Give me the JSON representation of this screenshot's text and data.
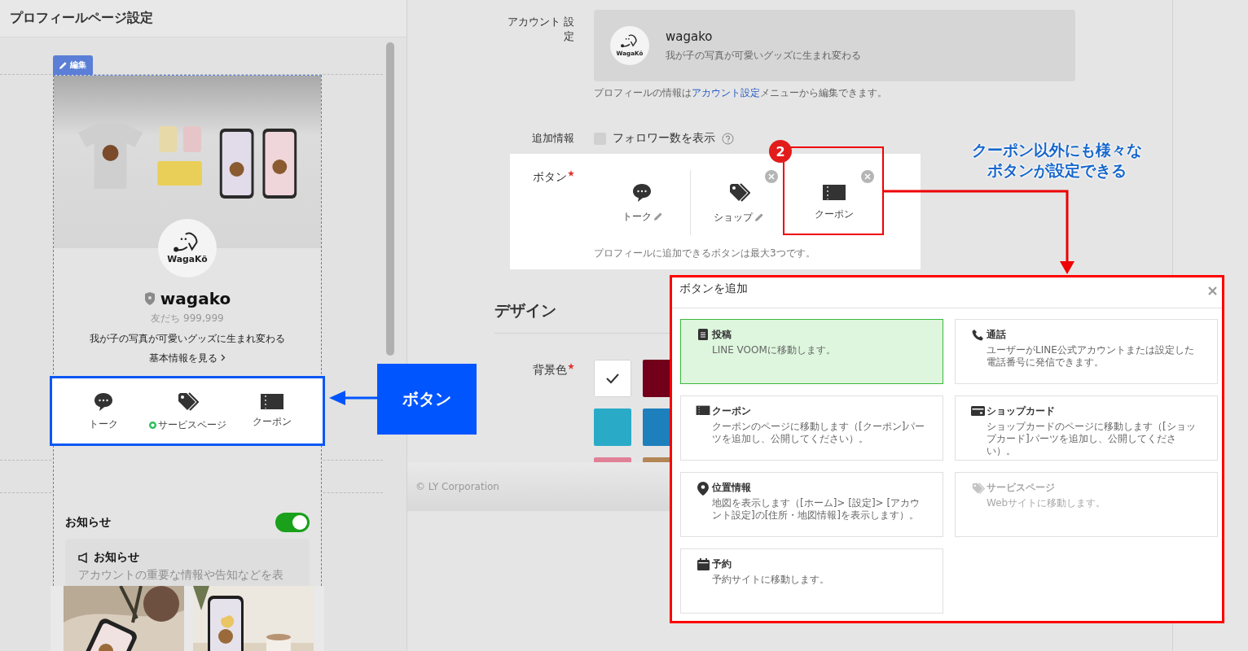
{
  "page_title": "プロフィールページ設定",
  "preview": {
    "edit_tab": "編集",
    "logo_text": "WagaKö",
    "account_name": "wagako",
    "friends": "友だち 999,999",
    "status_message": "我が子の写真が可愛いグッズに生まれ変わる",
    "info_link": "基本情報を見る",
    "buttons": [
      {
        "label": "トーク",
        "kind": "talk"
      },
      {
        "label": "サービスページ",
        "kind": "service"
      },
      {
        "label": "クーポン",
        "kind": "coupon"
      }
    ],
    "news": {
      "title": "お知らせ",
      "on": true,
      "card_title": "お知らせ",
      "card_text": "アカウントの重要な情報や告知などを表"
    }
  },
  "account": {
    "label": "アカウント 設定",
    "logo_text": "WagaKö",
    "name": "wagako",
    "description": "我が子の写真が可愛いグッズに生まれ変わる",
    "note_before": "プロフィールの情報は",
    "note_link": "アカウント設定",
    "note_after": "メニューから編集できます。"
  },
  "extra_info": {
    "label": "追加情報",
    "option": "フォロワー数を表示",
    "checked": false
  },
  "buttons_setting": {
    "label": "ボタン",
    "required": true,
    "items": [
      {
        "label": "トーク",
        "kind": "talk",
        "editable": true,
        "removable": false
      },
      {
        "label": "ショップ",
        "kind": "shop",
        "editable": true,
        "removable": true
      },
      {
        "label": "クーポン",
        "kind": "coupon",
        "editable": false,
        "removable": true
      }
    ],
    "note": "プロフィールに追加できるボタンは最大3つです。"
  },
  "design": {
    "heading": "デザイン",
    "background_label": "背景色",
    "required": true,
    "swatches": [
      {
        "color": "#ffffff",
        "selected": true
      },
      {
        "color": "#72001a",
        "selected": false
      },
      {
        "color": "#29abc8",
        "selected": false
      },
      {
        "color": "#1e7fbd",
        "selected": false
      },
      {
        "color": "#e08198",
        "selected": false
      },
      {
        "color": "#b38656",
        "selected": false
      }
    ]
  },
  "footer": "© LY Corporation",
  "dialog": {
    "title": "ボタンを追加",
    "options": [
      {
        "kind": "post",
        "title": "投稿",
        "description": "LINE VOOMに移動します。",
        "selected": true,
        "disabled": false
      },
      {
        "kind": "call",
        "title": "通話",
        "description": "ユーザーがLINE公式アカウントまたは設定した電話番号に発信できます。",
        "selected": false,
        "disabled": false
      },
      {
        "kind": "coupon",
        "title": "クーポン",
        "description": "クーポンのページに移動します（[クーポン]パーツを追加し、公開してください）。",
        "selected": false,
        "disabled": false
      },
      {
        "kind": "shopcard",
        "title": "ショップカード",
        "description": "ショップカードのページに移動します（[ショップカード]パーツを追加し、公開してください）。",
        "selected": false,
        "disabled": false
      },
      {
        "kind": "location",
        "title": "位置情報",
        "description": "地図を表示します（[ホーム]> [設定]> [アカウント設定]の[住所・地図情報]を表示します）。",
        "selected": false,
        "disabled": false
      },
      {
        "kind": "service",
        "title": "サービスページ",
        "description": "Webサイトに移動します。",
        "selected": false,
        "disabled": true
      },
      {
        "kind": "reserve",
        "title": "予約",
        "description": "予約サイトに移動します。",
        "selected": false,
        "disabled": false
      }
    ]
  },
  "annotations": {
    "step_badge": "2",
    "button_label": "ボタン",
    "callout_lines": [
      "クーポン以外にも様々な",
      "ボタンが設定できる"
    ]
  }
}
